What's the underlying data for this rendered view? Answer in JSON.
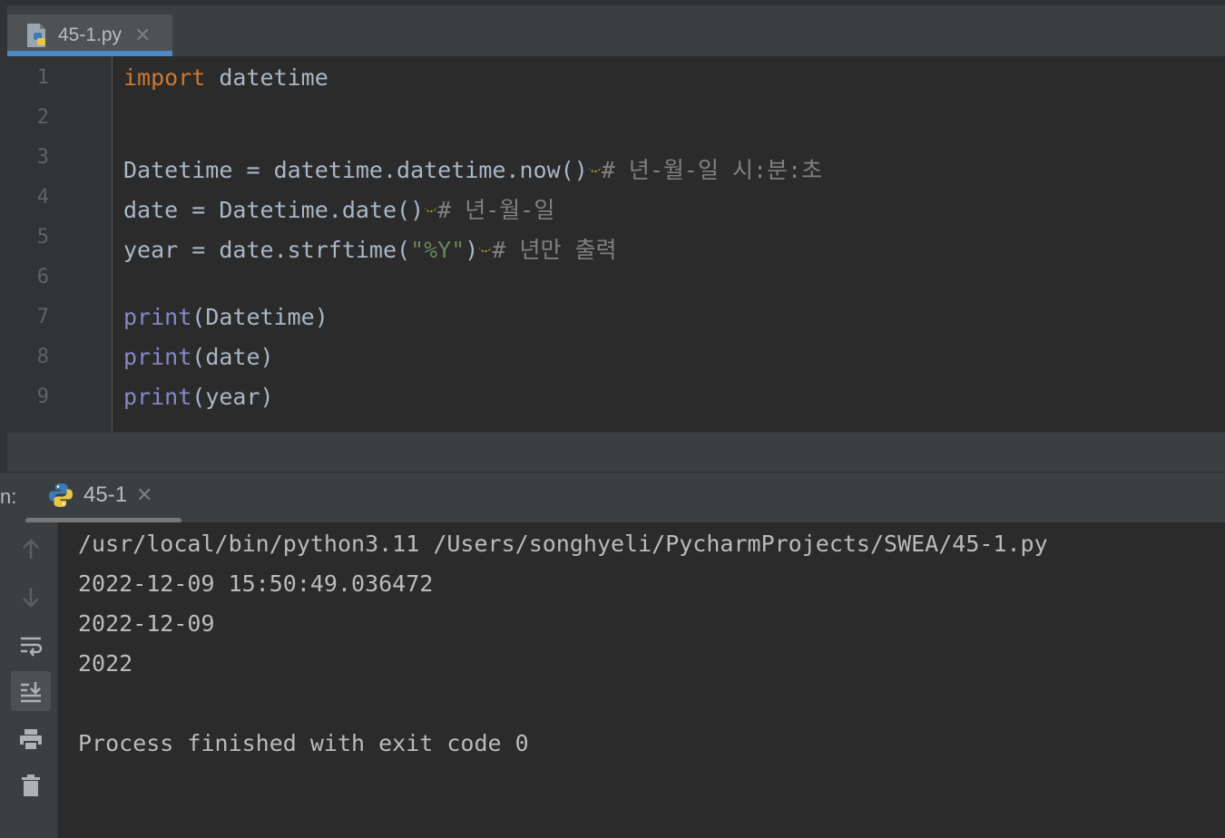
{
  "editor": {
    "tab": {
      "filename": "45-1.py",
      "close": "✕"
    },
    "lines": [
      {
        "num": "1",
        "tokens": [
          {
            "t": "import",
            "c": "kw"
          },
          {
            "t": " datetime",
            "c": ""
          }
        ]
      },
      {
        "num": "2",
        "tokens": []
      },
      {
        "num": "3",
        "tokens": [
          {
            "t": "Datetime = datetime.datetime.now()",
            "c": ""
          },
          {
            "t": "",
            "c": "squiggle"
          },
          {
            "t": "# 년-월-일 시:분:초",
            "c": "cmt"
          }
        ]
      },
      {
        "num": "4",
        "tokens": [
          {
            "t": "date = Datetime.date()",
            "c": ""
          },
          {
            "t": "",
            "c": "squiggle"
          },
          {
            "t": "# 년-월-일",
            "c": "cmt"
          }
        ]
      },
      {
        "num": "5",
        "tokens": [
          {
            "t": "year = date.strftime(",
            "c": ""
          },
          {
            "t": "\"%Y\"",
            "c": "str"
          },
          {
            "t": ")",
            "c": ""
          },
          {
            "t": "",
            "c": "squiggle"
          },
          {
            "t": "# 년만 출력",
            "c": "cmt"
          }
        ]
      },
      {
        "num": "6",
        "tokens": []
      },
      {
        "num": "7",
        "tokens": [
          {
            "t": "print",
            "c": "builtin"
          },
          {
            "t": "(Datetime)",
            "c": ""
          }
        ]
      },
      {
        "num": "8",
        "tokens": [
          {
            "t": "print",
            "c": "builtin"
          },
          {
            "t": "(date)",
            "c": ""
          }
        ]
      },
      {
        "num": "9",
        "tokens": [
          {
            "t": "print",
            "c": "builtin"
          },
          {
            "t": "(year)",
            "c": ""
          }
        ]
      }
    ]
  },
  "run": {
    "label": "n:",
    "tab": {
      "name": "45-1",
      "close": "✕"
    },
    "toolbar": [
      {
        "name": "scroll-up-icon",
        "active": false
      },
      {
        "name": "scroll-down-icon",
        "active": false
      },
      {
        "name": "soft-wrap-icon",
        "active": false
      },
      {
        "name": "scroll-to-end-icon",
        "active": true
      },
      {
        "name": "print-icon",
        "active": false
      },
      {
        "name": "trash-icon",
        "active": false
      }
    ],
    "console": [
      "/usr/local/bin/python3.11 /Users/songhyeli/PycharmProjects/SWEA/45-1.py",
      "2022-12-09 15:50:49.036472",
      "2022-12-09",
      "2022",
      "",
      "Process finished with exit code 0"
    ]
  },
  "colors": {
    "background": "#2b2b2b",
    "keyword": "#cc7832",
    "builtin": "#8888c6",
    "string": "#6a8759",
    "comment": "#808080",
    "tab_accent": "#4a88c7"
  }
}
